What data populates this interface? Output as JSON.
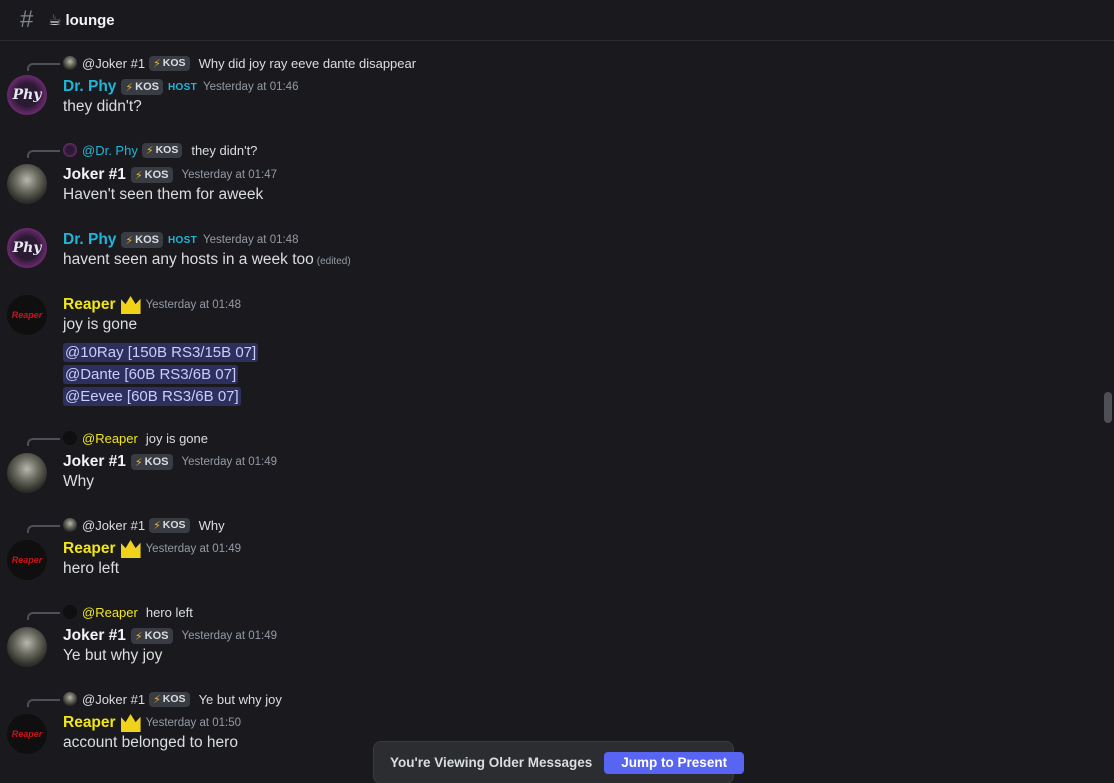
{
  "channel": {
    "hash_icon": "hash-icon",
    "emoji": "☕",
    "name": "lounge"
  },
  "bolt_glyph": "⚡",
  "messages": [
    {
      "reply": {
        "name": "@Joker #1",
        "tag": "KOS",
        "text": "Why did joy ray eeve dante disappear"
      },
      "author": "Dr. Phy",
      "tag": "KOS",
      "host": "HOST",
      "timestamp": "Yesterday at 01:46",
      "avatar": "Phy",
      "lines": [
        "they didn't?"
      ]
    },
    {
      "reply": {
        "name": "@Dr. Phy",
        "tag": "KOS",
        "text": "they didn't?"
      },
      "author": "Joker #1",
      "tag": "KOS",
      "timestamp": "Yesterday at 01:47",
      "lines": [
        "Haven't seen them for aweek"
      ]
    },
    {
      "author": "Dr. Phy",
      "tag": "KOS",
      "host": "HOST",
      "timestamp": "Yesterday at 01:48",
      "avatar": "Phy",
      "lines": [
        "havent seen any hosts in a week too"
      ],
      "edited": "(edited)"
    },
    {
      "author": "Reaper",
      "timestamp": "Yesterday at 01:48",
      "avatar": "Reaper",
      "lines": [
        "joy is gone"
      ],
      "mentions": [
        "@10Ray [150B RS3/15B 07]",
        "@Dante [60B RS3/6B 07]",
        "@Eevee [60B RS3/6B 07]"
      ]
    },
    {
      "reply": {
        "name": "@Reaper",
        "text": "joy is gone"
      },
      "author": "Joker #1",
      "tag": "KOS",
      "timestamp": "Yesterday at 01:49",
      "lines": [
        "Why"
      ]
    },
    {
      "reply": {
        "name": "@Joker #1",
        "tag": "KOS",
        "text": "Why"
      },
      "author": "Reaper",
      "timestamp": "Yesterday at 01:49",
      "avatar": "Reaper",
      "lines": [
        "hero left"
      ]
    },
    {
      "reply": {
        "name": "@Reaper",
        "text": "hero left"
      },
      "author": "Joker #1",
      "tag": "KOS",
      "timestamp": "Yesterday at 01:49",
      "lines": [
        "Ye but why joy"
      ]
    },
    {
      "reply": {
        "name": "@Joker #1",
        "tag": "KOS",
        "text": "Ye but why joy"
      },
      "author": "Reaper",
      "timestamp": "Yesterday at 01:50",
      "avatar": "Reaper",
      "lines": [
        "account belonged to hero"
      ]
    }
  ],
  "banner": {
    "text": "You're Viewing Older Messages",
    "button": "Jump to Present"
  },
  "colors": {
    "phy": "#1fb7d9",
    "reaper": "#f0e61a",
    "joker": "#f2f3f5",
    "accent": "#5865f2"
  }
}
